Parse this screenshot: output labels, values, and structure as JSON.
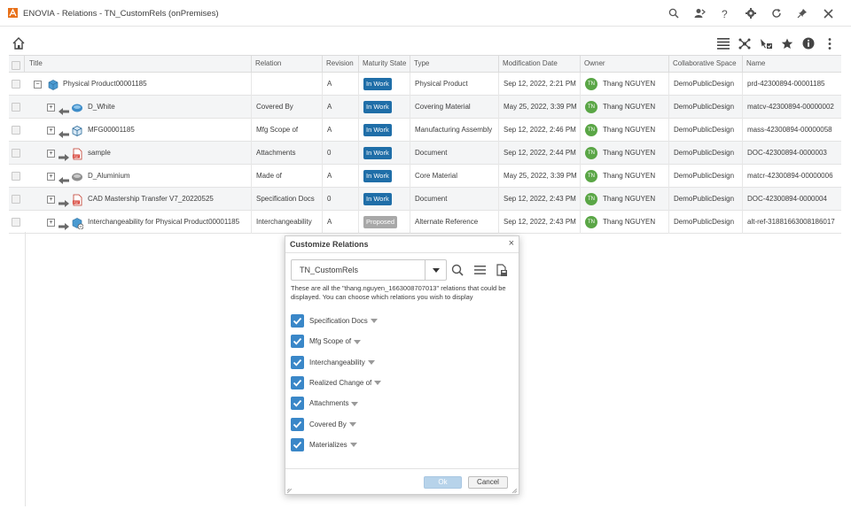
{
  "window": {
    "title": "ENOVIA - Relations - TN_CustomRels (onPremises)"
  },
  "title_icons": [
    "search-icon",
    "user-share-icon",
    "help-icon",
    "gear-icon",
    "refresh-icon",
    "pin-icon",
    "close-icon"
  ],
  "toolbar_icons": [
    "list-view-icon",
    "graph-view-icon",
    "select-mode-icon",
    "favorite-star-icon",
    "info-icon",
    "more-options-icon"
  ],
  "columns": [
    "Title",
    "Relation",
    "Revision",
    "Maturity State",
    "Type",
    "Modification Date",
    "Owner",
    "Collaborative Space",
    "Name"
  ],
  "rows": [
    {
      "title": "Physical Product00001185",
      "relation": "",
      "revision": "A",
      "state": "In Work",
      "state_color": "#1f6ea8",
      "type": "Physical Product",
      "date": "Sep 12, 2022, 2:21 PM",
      "owner_initials": "TN",
      "owner": "Thang NGUYEN",
      "space": "DemoPublicDesign",
      "name": "prd-42300894-00001185",
      "icon": "physical-product-icon",
      "dir": ""
    },
    {
      "title": "D_White",
      "relation": "Covered By",
      "revision": "A",
      "state": "In Work",
      "state_color": "#1f6ea8",
      "type": "Covering Material",
      "date": "May 25, 2022, 3:39 PM",
      "owner_initials": "TN",
      "owner": "Thang NGUYEN",
      "space": "DemoPublicDesign",
      "name": "matcv-42300894-00000002",
      "icon": "covering-material-icon",
      "dir": "left"
    },
    {
      "title": "MFG00001185",
      "relation": "Mfg Scope of",
      "revision": "A",
      "state": "In Work",
      "state_color": "#1f6ea8",
      "type": "Manufacturing Assembly",
      "date": "Sep 12, 2022, 2:46 PM",
      "owner_initials": "TN",
      "owner": "Thang NGUYEN",
      "space": "DemoPublicDesign",
      "name": "mass-42300894-00000058",
      "icon": "manufacturing-assembly-icon",
      "dir": "left"
    },
    {
      "title": "sample",
      "relation": "Attachments",
      "revision": "0",
      "state": "In Work",
      "state_color": "#1f6ea8",
      "type": "Document",
      "date": "Sep 12, 2022, 2:44 PM",
      "owner_initials": "TN",
      "owner": "Thang NGUYEN",
      "space": "DemoPublicDesign",
      "name": "DOC-42300894-0000003",
      "icon": "pdf-document-icon",
      "dir": "right"
    },
    {
      "title": "D_Aluminium",
      "relation": "Made of",
      "revision": "A",
      "state": "In Work",
      "state_color": "#1f6ea8",
      "type": "Core Material",
      "date": "May 25, 2022, 3:39 PM",
      "owner_initials": "TN",
      "owner": "Thang NGUYEN",
      "space": "DemoPublicDesign",
      "name": "matcr-42300894-00000006",
      "icon": "core-material-icon",
      "dir": "left"
    },
    {
      "title": "CAD Mastership Transfer V7_20220525",
      "relation": "Specification Docs",
      "revision": "0",
      "state": "In Work",
      "state_color": "#1f6ea8",
      "type": "Document",
      "date": "Sep 12, 2022, 2:43 PM",
      "owner_initials": "TN",
      "owner": "Thang NGUYEN",
      "space": "DemoPublicDesign",
      "name": "DOC-42300894-0000004",
      "icon": "pdf-document-icon",
      "dir": "right"
    },
    {
      "title": "Interchangeability for Physical Product00001185",
      "relation": "Interchangeability",
      "revision": "A",
      "state": "Proposed",
      "state_color": "#a8a8a8",
      "type": "Alternate Reference",
      "date": "Sep 12, 2022, 2:43 PM",
      "owner_initials": "TN",
      "owner": "Thang NGUYEN",
      "space": "DemoPublicDesign",
      "name": "alt-ref-31881663008186017",
      "icon": "alternate-reference-icon",
      "dir": "right"
    }
  ],
  "dialog": {
    "title": "Customize Relations",
    "select_value": "TN_CustomRels",
    "description": "These are all the \"thang.nguyen_1663008707013\" relations that could be displayed. You can choose which relations you wish to display",
    "relations": [
      "Specification Docs",
      "Mfg Scope of",
      "Interchangeability",
      "Realized Change of",
      "Attachments",
      "Covered By",
      "Materializes"
    ],
    "ok_label": "Ok",
    "cancel_label": "Cancel"
  }
}
